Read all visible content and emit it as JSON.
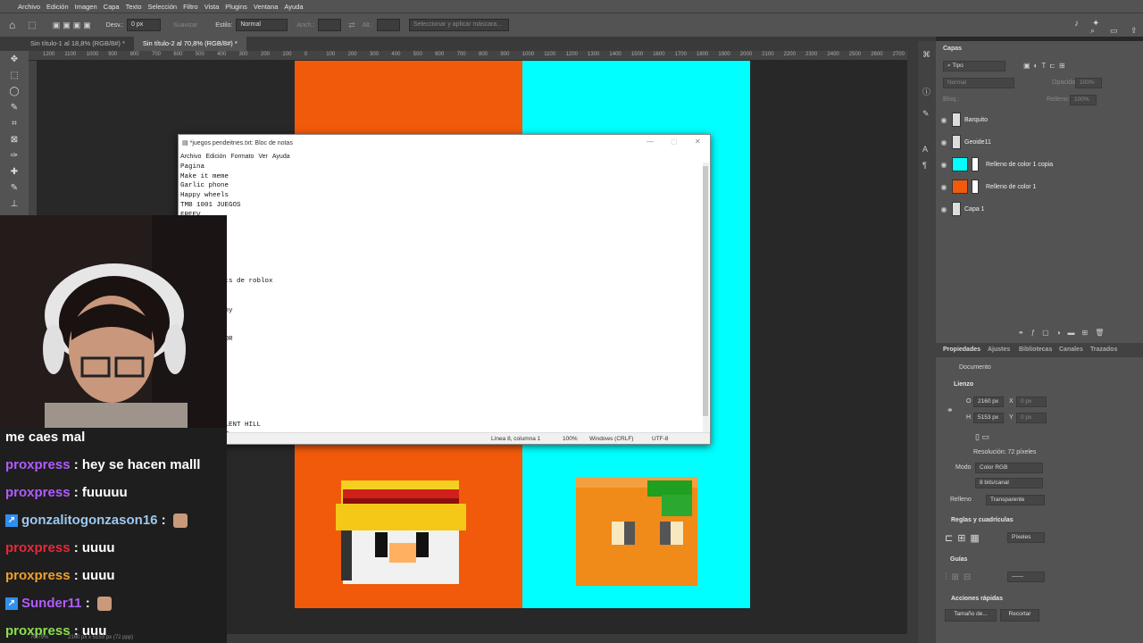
{
  "menubar": {
    "items": [
      "Archivo",
      "Edición",
      "Imagen",
      "Capa",
      "Texto",
      "Selección",
      "Filtro",
      "Vista",
      "Plugins",
      "Ventana",
      "Ayuda"
    ]
  },
  "options": {
    "desv_label": "Desv.:",
    "desv_value": "0 px",
    "suavizar": "Suavizar",
    "estilo_label": "Estilo:",
    "estilo_value": "Normal",
    "anch_label": "Anch.:",
    "alt_label": "Alt.:",
    "mask_button": "Seleccionar y aplicar máscara..."
  },
  "tabs": [
    {
      "label": "Sin título-1 al 18,8% (RGB/8#) *"
    },
    {
      "label": "Sin título-2 al 70,8% (RGB/8#) *"
    }
  ],
  "ruler": [
    "1200",
    "1100",
    "1000",
    "900",
    "800",
    "700",
    "600",
    "500",
    "400",
    "300",
    "200",
    "100",
    "0",
    "100",
    "200",
    "300",
    "400",
    "500",
    "600",
    "700",
    "800",
    "900",
    "1000",
    "1100",
    "1200",
    "1300",
    "1400",
    "1500",
    "1600",
    "1700",
    "1800",
    "1900",
    "2000",
    "2100",
    "2200",
    "2300",
    "2400",
    "2500",
    "2600",
    "2700",
    "2800"
  ],
  "notepad": {
    "title": "*juegos pendeitnes.txt: Bloc de notas",
    "menu": [
      "Archivo",
      "Edición",
      "Formato",
      "Ver",
      "Ayuda"
    ],
    "text": "Pagina\nMake it meme\nGarlic phone\nHappy wheels\nTMB 1001 JUEGOS\nFREEV\n\n\n\n\n\n\n          nts de roblox\n\n\n          any\n\n\n          TOR\n\n\n\n\n\n          4\n\n\n          ILENT HILL\n          HT\n          Cre",
    "status": {
      "pos": "Línea 8, columna 1",
      "zoom": "100%",
      "eol": "Windows (CRLF)",
      "enc": "UTF-8"
    }
  },
  "chat": [
    {
      "user": "",
      "text": "me caes mal",
      "color": "#ffffff",
      "badge": false,
      "emote": false
    },
    {
      "user": "proxpress",
      "text": " : hey se hacen malll",
      "color": "#b05cff",
      "badge": false,
      "emote": false
    },
    {
      "user": "proxpress",
      "text": " : fuuuuu",
      "color": "#b05cff",
      "badge": false,
      "emote": false
    },
    {
      "user": "gonzalitogonzason16",
      "text": " : ",
      "color": "#9ec8f0",
      "badge": true,
      "emote": true
    },
    {
      "user": "proxpress",
      "text": " : uuuu",
      "color": "#e8283a",
      "badge": false,
      "emote": false
    },
    {
      "user": "proxpress",
      "text": " : uuuu",
      "color": "#f0a030",
      "badge": false,
      "emote": false
    },
    {
      "user": "Sunder11",
      "text": " : ",
      "color": "#b05cff",
      "badge": true,
      "emote": true
    },
    {
      "user": "proxpress",
      "text": " : uuu",
      "color": "#8ce050",
      "badge": false,
      "emote": false
    }
  ],
  "layers_panel": {
    "title": "Capas",
    "filter": "Tipo",
    "blend": "Normal",
    "opacity_label": "Opacidad:",
    "opacity_value": "100%",
    "lock_label": "Bloq.:",
    "fill_label": "Relleno:",
    "fill_value": "100%",
    "layers": [
      {
        "name": "Barquito",
        "thumb": "#dddddd"
      },
      {
        "name": "Geoide11",
        "thumb": "#dddddd"
      },
      {
        "name": "Relleno de color 1 copia",
        "thumb": "#00ffff"
      },
      {
        "name": "Relleno de color 1",
        "thumb": "#f05a0a"
      },
      {
        "name": "Capa 1",
        "thumb": "#dddddd"
      }
    ]
  },
  "properties": {
    "tabs": [
      "Propiedades",
      "Ajustes",
      "Bibliotecas",
      "Canales",
      "Trazados"
    ],
    "doc_label": "Documento",
    "lienzo": "Lienzo",
    "w_label": "O",
    "w_value": "2160 px",
    "x_label": "X",
    "x_value": "0 px",
    "h_label": "H",
    "h_value": "5153 px",
    "y_label": "Y",
    "y_value": "0 px",
    "resolution": "Resolución: 72 píxeles",
    "modo_label": "Modo",
    "modo_value": "Color RGB",
    "bits_value": "8 bits/canal",
    "relleno_label": "Relleno",
    "relleno_value": "Transparente",
    "reglas": "Reglas y cuadrículas",
    "pixels": "Píxeles",
    "guias": "Guías",
    "acciones": "Acciones rápidas",
    "btn_size": "Tamaño de...",
    "btn_crop": "Recortar"
  },
  "statusbar": {
    "zoom": "70,79%",
    "size": "2160 px x 5153 px (72 ppp)"
  }
}
